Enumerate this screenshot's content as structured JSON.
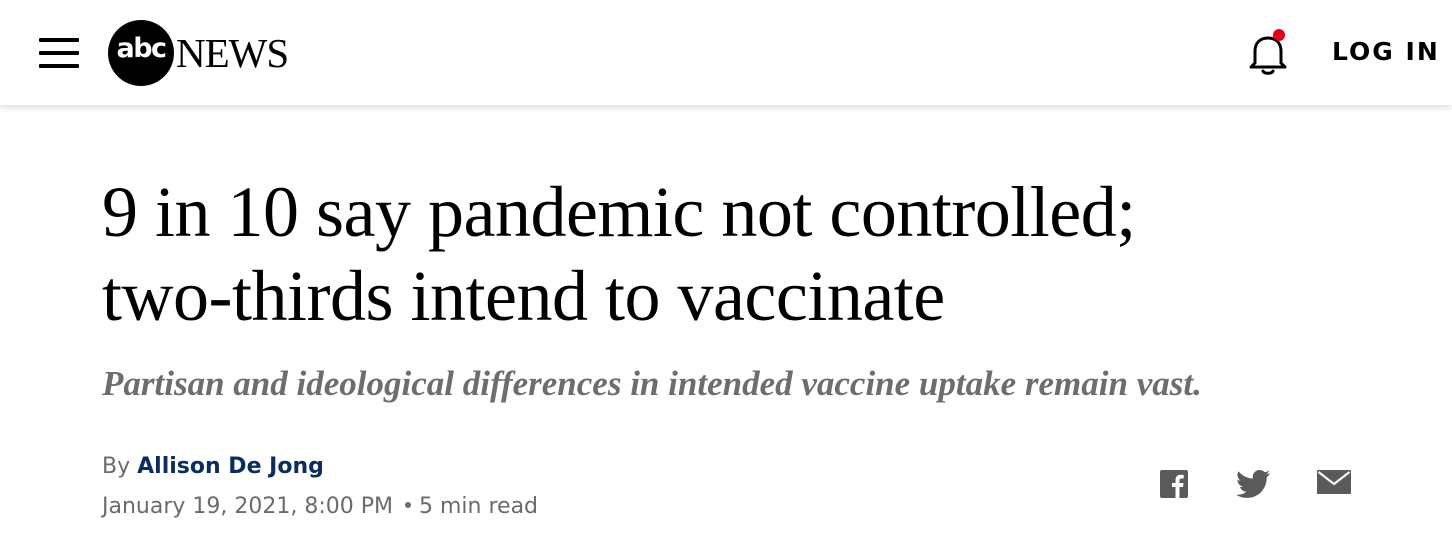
{
  "header": {
    "logo_mark": "abc",
    "logo_text": "NEWS",
    "login_label": "LOG IN",
    "menu_icon": "hamburger-menu-icon",
    "notification_icon": "bell-icon",
    "notification_dot_color": "#e4001b"
  },
  "article": {
    "headline_line1": "9 in 10 say pandemic not controlled;",
    "headline_line2": "two-thirds intend to vaccinate",
    "subheadline": "Partisan and ideological differences in intended vaccine uptake remain vast.",
    "byline_prefix": "By",
    "author": "Allison De Jong",
    "date": "January 19, 2021, 8:00 PM",
    "read_time": "5 min read",
    "author_color": "#0a2c5f"
  },
  "share": {
    "icons": [
      "facebook-icon",
      "twitter-icon",
      "email-icon"
    ],
    "icon_color": "#5a5a5a"
  }
}
